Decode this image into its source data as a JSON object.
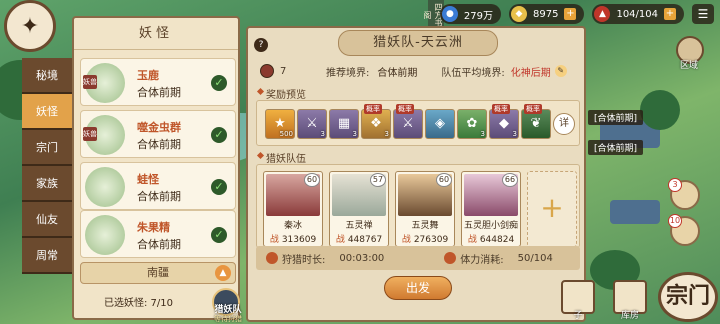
{
  "top_bar": {
    "resources": [
      {
        "icon": "water-drop-icon",
        "value": "279万"
      },
      {
        "icon": "spirit-stone-icon",
        "value": "8975"
      },
      {
        "icon": "stamina-flask-icon",
        "value": "104/104"
      }
    ]
  },
  "left_tabs": [
    "秘境",
    "妖怪",
    "宗门",
    "家族",
    "仙友",
    "周常"
  ],
  "active_tab": "妖怪",
  "yaoguai_panel": {
    "title": "妖怪",
    "items": [
      {
        "tag": "妖兽",
        "name": "玉鹿",
        "realm": "合体前期"
      },
      {
        "tag": "妖兽",
        "name": "噬金虫群",
        "realm": "合体前期"
      },
      {
        "tag": "",
        "name": "蛙怪",
        "realm": "合体前期"
      },
      {
        "tag": "",
        "name": "朱果精",
        "realm": "合体前期"
      }
    ],
    "region": "南疆",
    "selected": "已选妖怪: 7/10"
  },
  "hunt_button": {
    "title": "猎妖队",
    "subtitle": "等待狩猎"
  },
  "hunt_panel": {
    "title": "猎妖队-天云洲",
    "count": "7",
    "recommended_label": "推荐境界:",
    "recommended_value": "合体前期",
    "avg_label": "队伍平均境界:",
    "avg_value": "化神后期",
    "reward_section": "奖励预览",
    "rewards": [
      {
        "count": "500",
        "badge": ""
      },
      {
        "count": "3",
        "badge": ""
      },
      {
        "count": "3",
        "badge": ""
      },
      {
        "count": "3",
        "badge": "概率"
      },
      {
        "count": "",
        "badge": "概率"
      },
      {
        "count": "",
        "badge": ""
      },
      {
        "count": "3",
        "badge": ""
      },
      {
        "count": "3",
        "badge": "概率"
      },
      {
        "count": "",
        "badge": "概率"
      }
    ],
    "detail_label": "详",
    "team_section": "猎妖队伍",
    "members": [
      {
        "name": "秦冰",
        "level": "60",
        "power": "313609"
      },
      {
        "name": "五灵禅",
        "level": "57",
        "power": "448767"
      },
      {
        "name": "五灵舞",
        "level": "60",
        "power": "276309"
      },
      {
        "name": "五灵胆小剑痴",
        "level": "66",
        "power": "644824"
      }
    ],
    "power_label": "战",
    "time_label": "狩猎时长:",
    "time_value": "00:03:00",
    "stamina_label": "体力消耗:",
    "stamina_value": "50/104",
    "go_label": "出发"
  },
  "right_side": {
    "region_label": "区域",
    "map_labels": [
      "[合体前期]",
      "[合体前期]"
    ],
    "badge_nums": [
      "3",
      "10"
    ],
    "bottom_nav": [
      "子",
      "库房"
    ],
    "sect": "宗门",
    "sign_text": "四方书阁"
  }
}
